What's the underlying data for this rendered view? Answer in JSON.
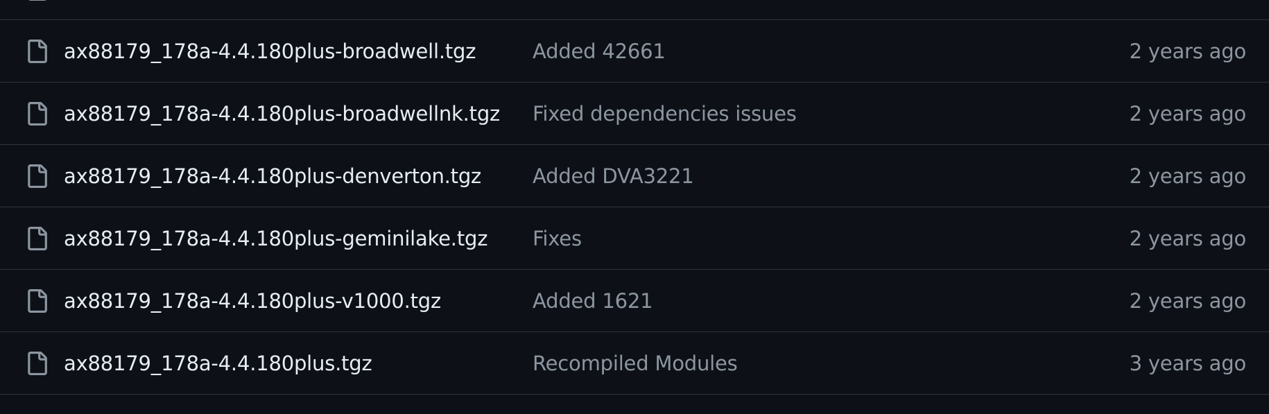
{
  "colors": {
    "background": "#0d1117",
    "border": "#30363d",
    "file_name": "#e6edf3",
    "muted": "#8d96a0",
    "icon": "#8d96a0"
  },
  "files": [
    {
      "name": "ax88179_178a-4.4.180plus-broadwell.tgz",
      "commit_message": "Added 42661",
      "time": "2 years ago",
      "icon": "file-icon"
    },
    {
      "name": "ax88179_178a-4.4.180plus-broadwellnk.tgz",
      "commit_message": "Fixed dependencies issues",
      "time": "2 years ago",
      "icon": "file-icon"
    },
    {
      "name": "ax88179_178a-4.4.180plus-denverton.tgz",
      "commit_message": "Added DVA3221",
      "time": "2 years ago",
      "icon": "file-icon"
    },
    {
      "name": "ax88179_178a-4.4.180plus-geminilake.tgz",
      "commit_message": "Fixes",
      "time": "2 years ago",
      "icon": "file-icon"
    },
    {
      "name": "ax88179_178a-4.4.180plus-v1000.tgz",
      "commit_message": "Added 1621",
      "time": "2 years ago",
      "icon": "file-icon"
    },
    {
      "name": "ax88179_178a-4.4.180plus.tgz",
      "commit_message": "Recompiled Modules",
      "time": "3 years ago",
      "icon": "file-icon"
    }
  ]
}
